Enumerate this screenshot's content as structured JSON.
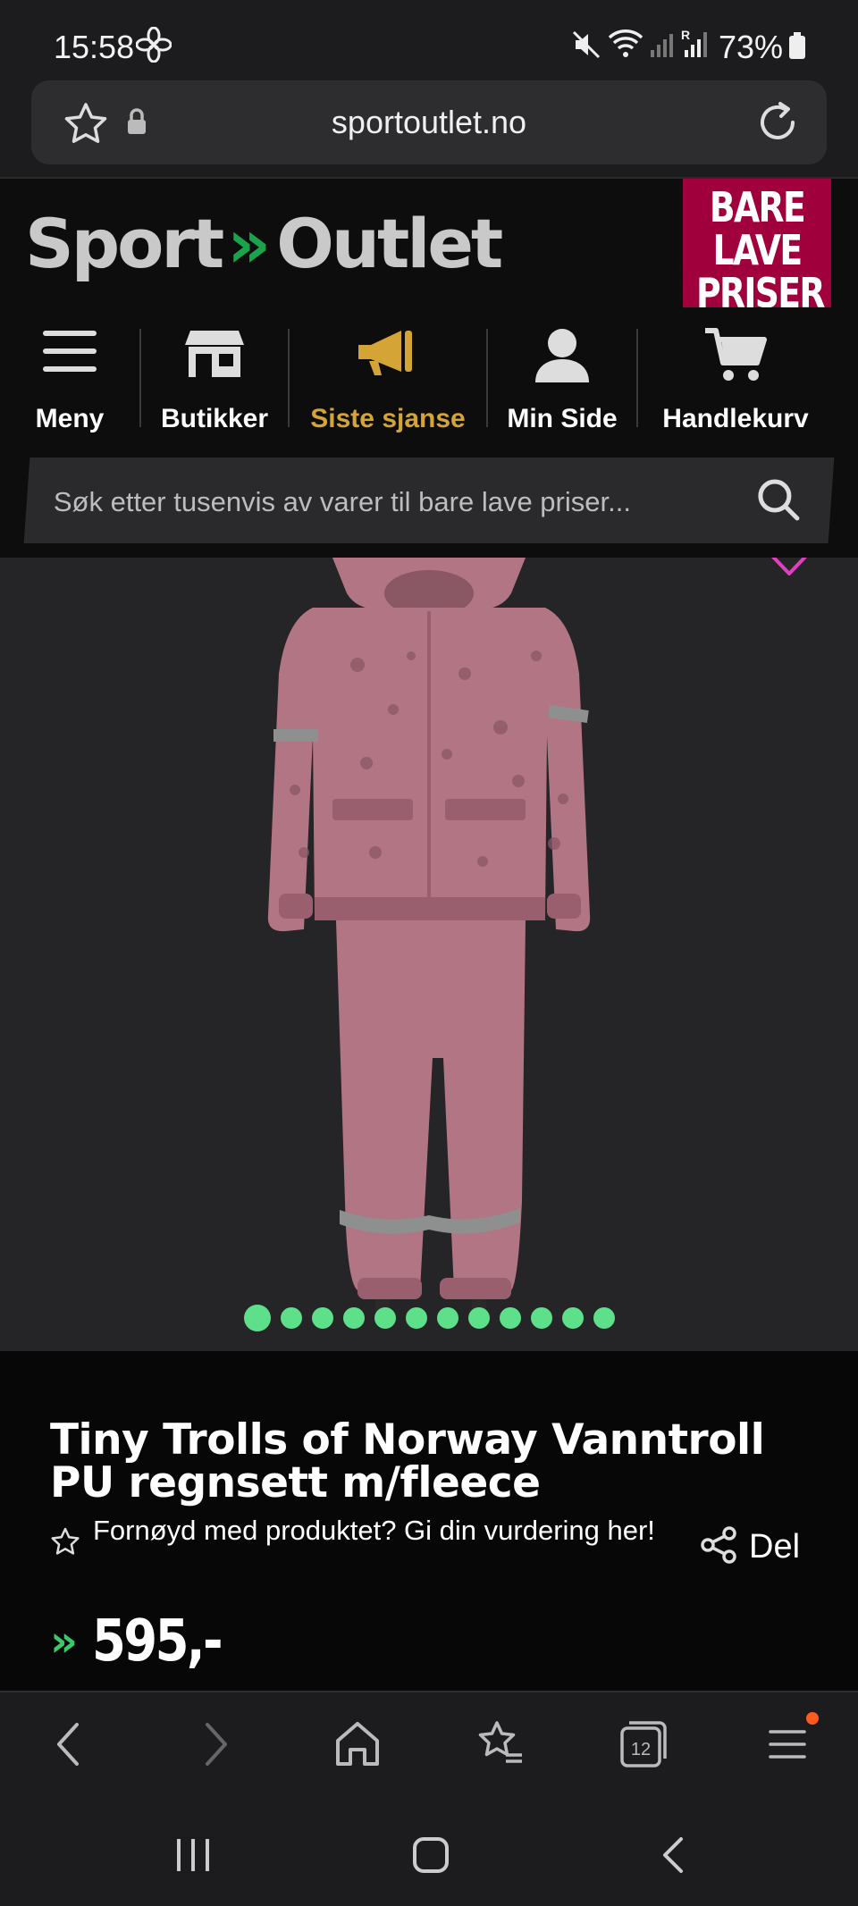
{
  "status_bar": {
    "time": "15:58",
    "battery": "73%",
    "icons": [
      "fan-icon",
      "mute-icon",
      "wifi-icon",
      "signal-icon",
      "signal-roaming-icon",
      "battery-icon"
    ]
  },
  "browser": {
    "url": "sportoutlet.no",
    "icons": [
      "star-icon",
      "lock-icon",
      "reload-icon"
    ]
  },
  "header": {
    "logo_left": "Sport",
    "logo_chevron": "»",
    "logo_right": "Outlet",
    "promo": [
      "BARE",
      "LAVE",
      "PRISER"
    ]
  },
  "nav": {
    "items": [
      {
        "label": "Meny",
        "icon": "menu-icon"
      },
      {
        "label": "Butikker",
        "icon": "store-icon"
      },
      {
        "label": "Siste sjanse",
        "icon": "megaphone-icon"
      },
      {
        "label": "Min Side",
        "icon": "user-icon"
      },
      {
        "label": "Handlekurv",
        "icon": "cart-icon"
      }
    ]
  },
  "search": {
    "placeholder": "Søk etter tusenvis av varer til bare lave priser..."
  },
  "gallery": {
    "image_count": 12,
    "active_index": 0
  },
  "product": {
    "title": "Tiny Trolls of Norway Vanntroll PU regnsett m/fleece",
    "rating_prompt": "Fornøyd med produktet? Gi din vurdering her!",
    "share_label": "Del",
    "price_chevron": "»",
    "price": "595,-"
  },
  "toolbar": {
    "tab_count": "12",
    "icons": [
      "back-icon",
      "forward-icon",
      "home-icon",
      "bookmarks-icon",
      "tabs-icon",
      "menu-icon"
    ]
  },
  "system_nav": {
    "icons": [
      "recents-icon",
      "home-button-icon",
      "back-icon"
    ]
  },
  "colors": {
    "accent_green": "#1aa34a",
    "dots_green": "#5ee08a",
    "siste_sjanse": "#d4a536",
    "promo_bg": "#a0003c",
    "background": "#111113"
  }
}
